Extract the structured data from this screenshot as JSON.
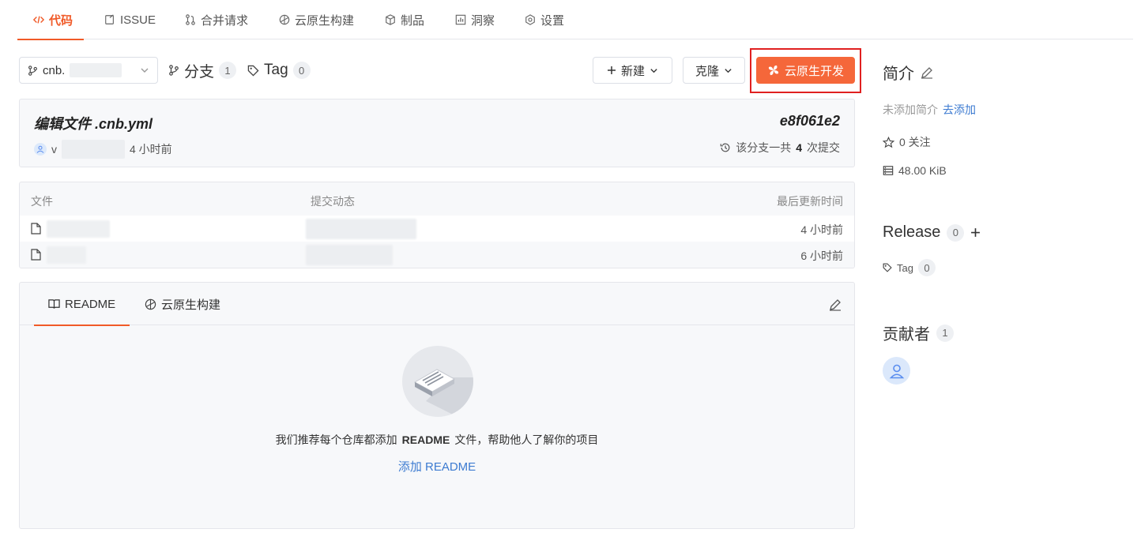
{
  "nav": {
    "tabs": [
      {
        "label": "代码",
        "icon": "code-icon",
        "active": true
      },
      {
        "label": "ISSUE",
        "icon": "issue-icon"
      },
      {
        "label": "合并请求",
        "icon": "merge-request-icon"
      },
      {
        "label": "云原生构建",
        "icon": "cloud-build-icon"
      },
      {
        "label": "制品",
        "icon": "package-icon"
      },
      {
        "label": "洞察",
        "icon": "chart-icon"
      },
      {
        "label": "设置",
        "icon": "settings-icon"
      }
    ]
  },
  "toolbar": {
    "branch_prefix": "cnb.",
    "branches_label": "分支",
    "branches_count": "1",
    "tag_label": "Tag",
    "tag_count": "0",
    "new_label": "新建",
    "clone_label": "克隆",
    "cloud_dev_label": "云原生开发",
    "accent_color": "#f5673a",
    "highlight_color": "#e02020"
  },
  "commit": {
    "title": "编辑文件 .cnb.yml",
    "hash": "e8f061e2",
    "user_initial": "v",
    "time": "4 小时前",
    "count_prefix": "该分支一共",
    "count": "4",
    "count_suffix": "次提交"
  },
  "files": {
    "headers": {
      "name": "文件",
      "commit": "提交动态",
      "updated": "最后更新时间"
    },
    "rows": [
      {
        "time": "4 小时前"
      },
      {
        "time": "6 小时前"
      }
    ]
  },
  "readme": {
    "tab_readme": "README",
    "tab_build": "云原生构建",
    "empty_prefix": "我们推荐每个仓库都添加",
    "empty_bold": "README",
    "empty_suffix": "文件，帮助他人了解你的项目",
    "add_link": "添加 README"
  },
  "sidebar": {
    "intro_title": "简介",
    "no_intro": "未添加简介",
    "add_intro": "去添加",
    "stars": "0 关注",
    "size": "48.00 KiB",
    "release_title": "Release",
    "release_count": "0",
    "tag_label": "Tag",
    "tag_count": "0",
    "contributors_title": "贡献者",
    "contributors_count": "1"
  }
}
